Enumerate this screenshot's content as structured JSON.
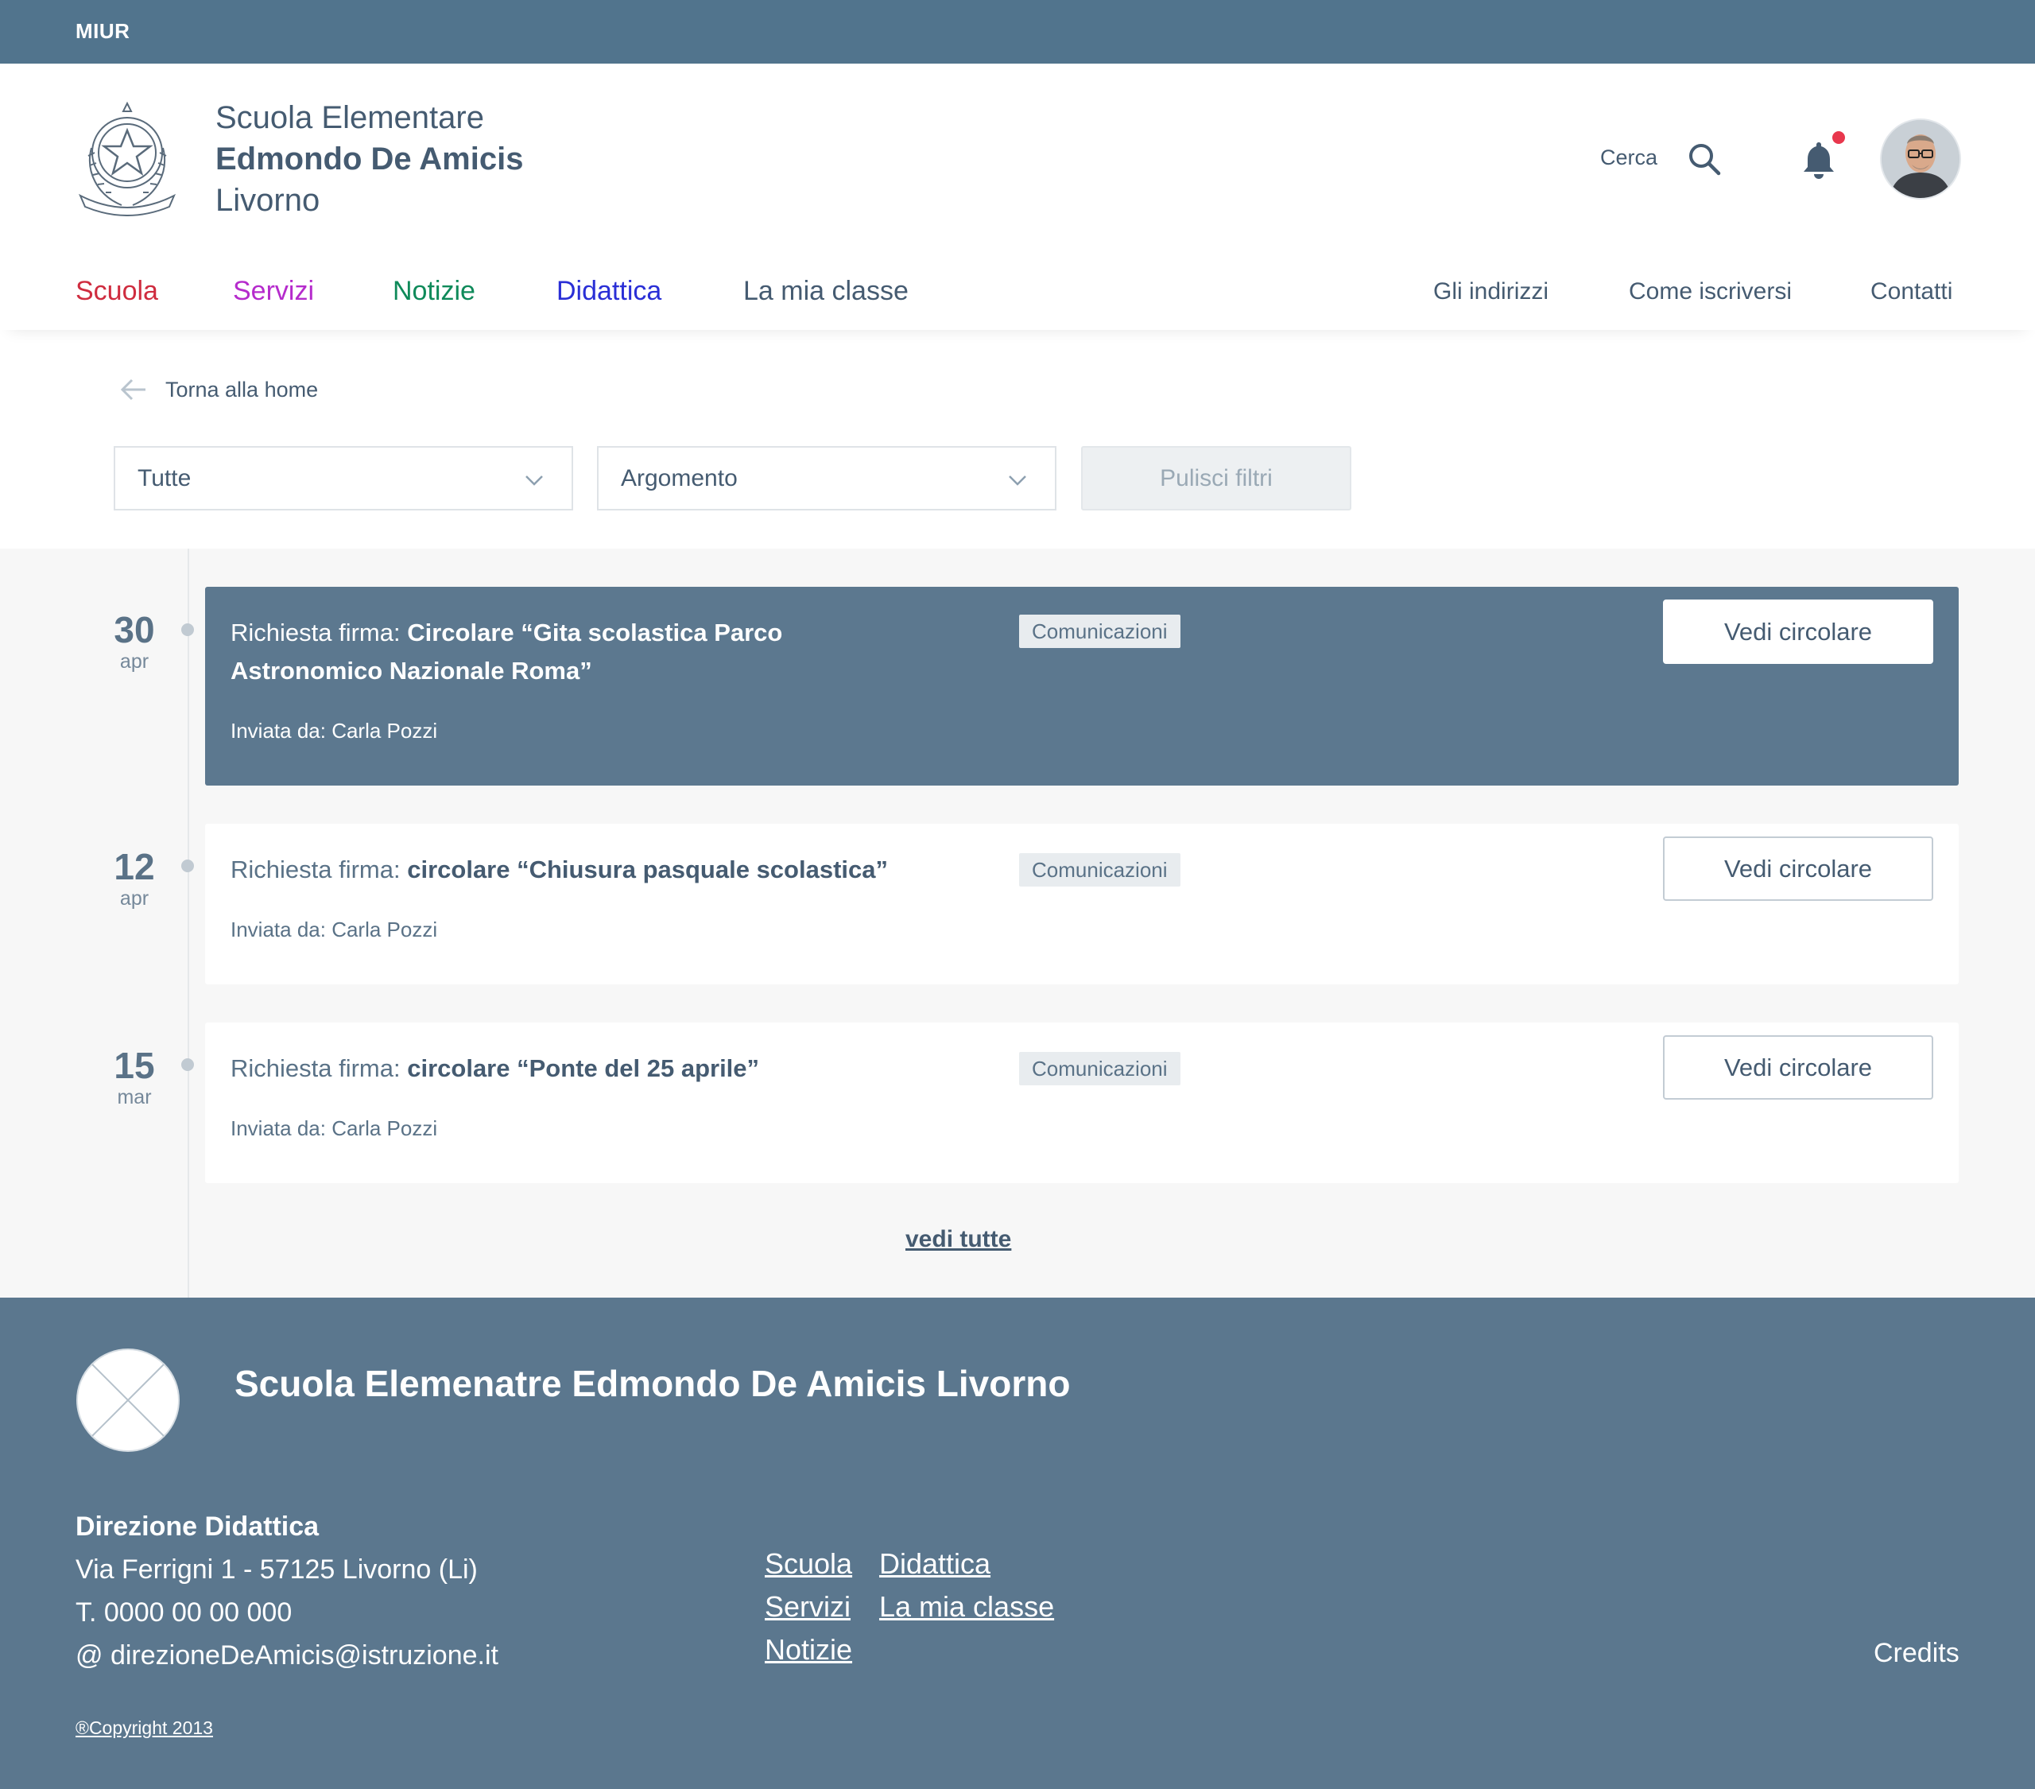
{
  "topbar": {
    "label": "MIUR"
  },
  "header": {
    "school_line1": "Scuola Elementare",
    "school_line2": "Edmondo De Amicis",
    "school_line3": "Livorno",
    "search_label": "Cerca",
    "notification_icon": "bell-icon",
    "search_icon": "search-icon"
  },
  "nav": {
    "main": [
      {
        "label": "Scuola",
        "color": "#cf2c3f"
      },
      {
        "label": "Servizi",
        "color": "#b52bcc"
      },
      {
        "label": "Notizie",
        "color": "#0f8a5a"
      },
      {
        "label": "Didattica",
        "color": "#2a2fd6"
      },
      {
        "label": "La mia classe",
        "color": "#455b71"
      }
    ],
    "secondary": [
      "Gli indirizzi",
      "Come iscriversi",
      "Contatti"
    ]
  },
  "back_link": {
    "label": "Torna alla home"
  },
  "filters": {
    "type_select": "Tutte",
    "topic_select": "Argomento",
    "clear_button": "Pulisci filtri"
  },
  "circolari": [
    {
      "day": "30",
      "month": "apr",
      "prefix": "Richiesta firma: ",
      "title": "Circolare  “Gita scolastica Parco Astronomico Nazionale Roma”",
      "sender": "Inviata da: Carla Pozzi",
      "badge": "Comunicazioni",
      "cta": "Vedi circolare",
      "featured": true
    },
    {
      "day": "12",
      "month": "apr",
      "prefix": "Richiesta firma: ",
      "title": "circolare “Chiusura pasquale scolastica”",
      "sender": "Inviata da: Carla Pozzi",
      "badge": "Comunicazioni",
      "cta": "Vedi circolare",
      "featured": false
    },
    {
      "day": "15",
      "month": "mar",
      "prefix": "Richiesta firma: ",
      "title": "circolare “Ponte del 25 aprile”",
      "sender": "Inviata da: Carla Pozzi",
      "badge": "Comunicazioni",
      "cta": "Vedi circolare",
      "featured": false
    }
  ],
  "vedi_tutte": "vedi tutte",
  "footer": {
    "title": "Scuola Elemenatre Edmondo De Amicis Livorno",
    "address_heading": "Direzione Didattica",
    "address_line": "Via Ferrigni 1 - 57125 Livorno (Li)",
    "phone": "T. 0000 00 00 000",
    "email": "@ direzioneDeAmicis@istruzione.it",
    "links_col1": [
      "Scuola",
      "Servizi",
      "Notizie"
    ],
    "links_col2": [
      "Didattica",
      "La mia classe"
    ],
    "credits": "Credits",
    "copyright": "®Copyright 2013"
  }
}
